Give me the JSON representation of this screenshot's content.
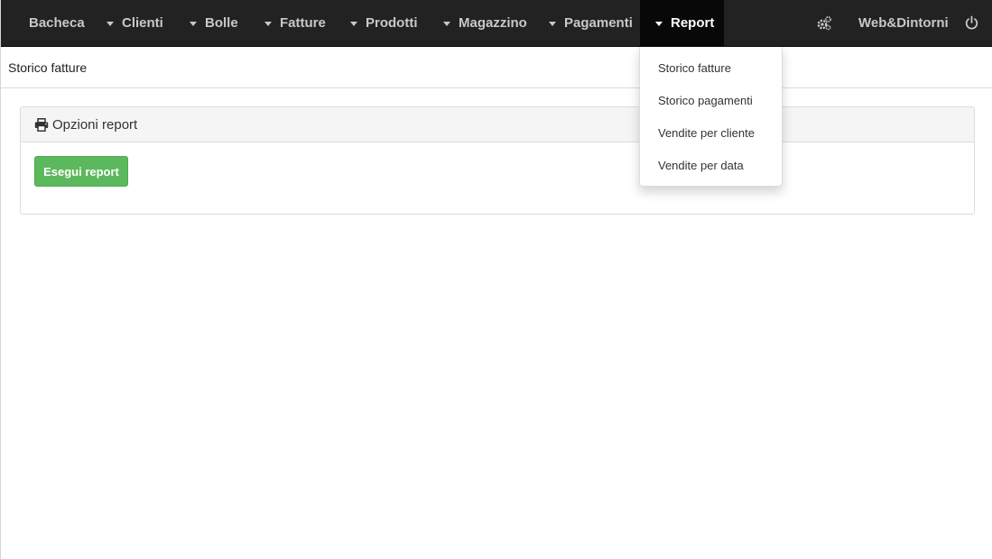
{
  "navbar": {
    "items": [
      {
        "label": "Bacheca",
        "has_caret": false
      },
      {
        "label": "Clienti",
        "has_caret": true
      },
      {
        "label": "Bolle",
        "has_caret": true
      },
      {
        "label": "Fatture",
        "has_caret": true
      },
      {
        "label": "Prodotti",
        "has_caret": true
      },
      {
        "label": "Magazzino",
        "has_caret": true
      },
      {
        "label": "Pagamenti",
        "has_caret": true
      },
      {
        "label": "Report",
        "has_caret": true,
        "active": true
      }
    ],
    "settings_icon": "gears-icon",
    "company": "Web&Dintorni",
    "power_icon": "power-icon",
    "colors": {
      "background": "#222222",
      "active_background": "#080808",
      "text": "#c8c8c8"
    }
  },
  "breadcrumb": {
    "title": "Storico fatture"
  },
  "panel": {
    "heading_icon": "printer-icon",
    "heading": "Opzioni report",
    "run_button": "Esegui report",
    "run_button_color": "#5cb85c"
  },
  "report_menu": {
    "items": [
      {
        "label": "Storico fatture"
      },
      {
        "label": "Storico pagamenti"
      },
      {
        "label": "Vendite per cliente"
      },
      {
        "label": "Vendite per data"
      }
    ]
  }
}
